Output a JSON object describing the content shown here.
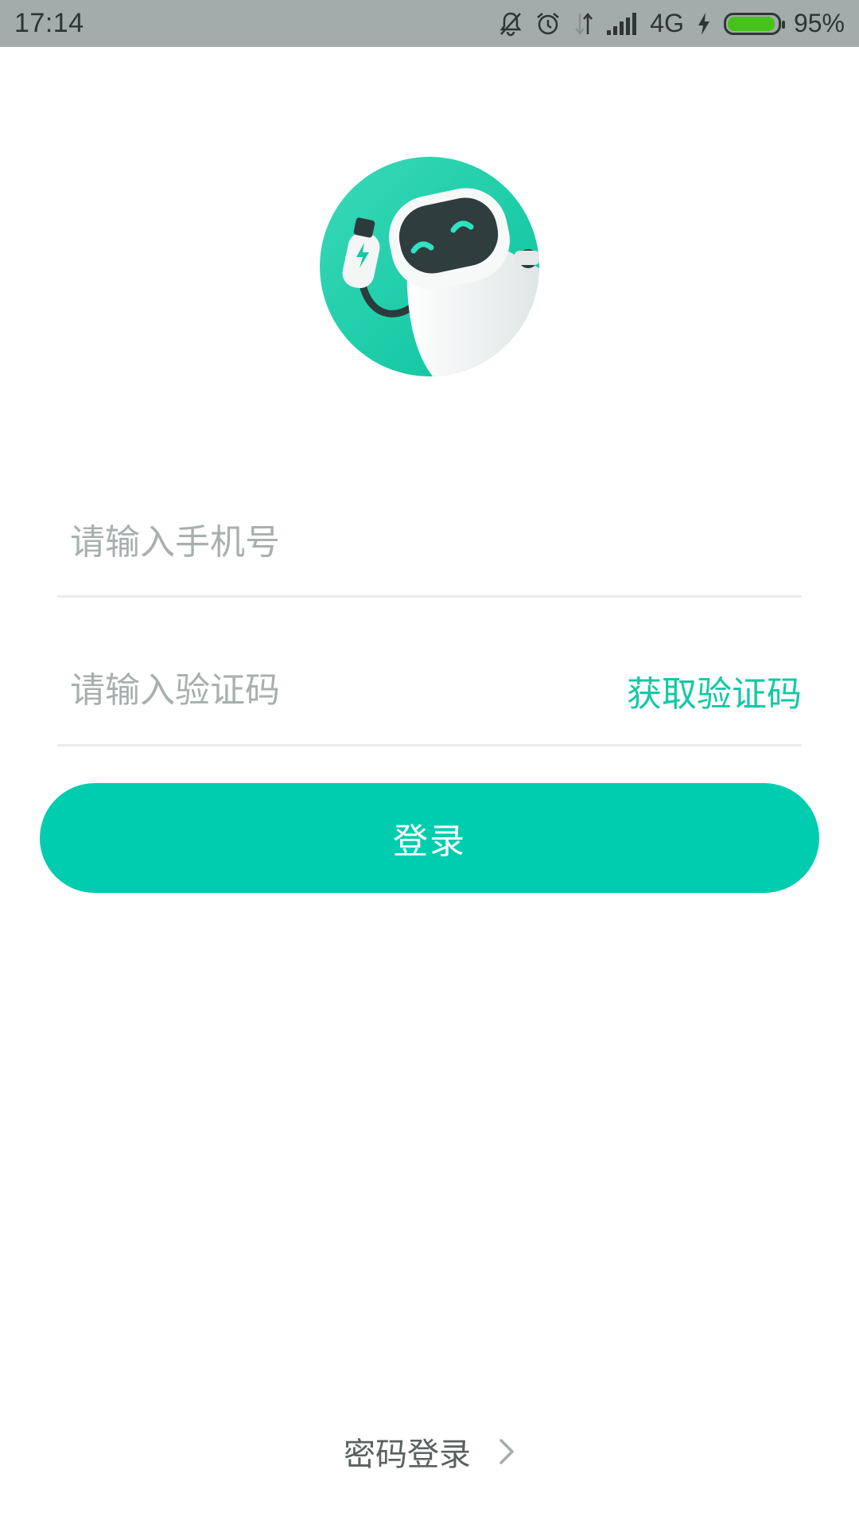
{
  "status_bar": {
    "time": "17:14",
    "network": "4G",
    "battery_percent": "95%",
    "battery_level": 0.95,
    "icons": [
      "bell-off-icon",
      "alarm-icon",
      "data-arrows-icon",
      "signal-icon",
      "charging-icon",
      "battery-icon"
    ]
  },
  "avatar": {
    "icon": "robot-mascot-icon",
    "accent_color": "#1fcfa9"
  },
  "form": {
    "phone_placeholder": "请输入手机号",
    "phone_value": "",
    "code_placeholder": "请输入验证码",
    "code_value": "",
    "get_code_label": "获取验证码"
  },
  "login_button": {
    "label": "登录",
    "color": "#00cdaf"
  },
  "footer": {
    "password_login_label": "密码登录",
    "icon": "chevron-right-icon"
  }
}
